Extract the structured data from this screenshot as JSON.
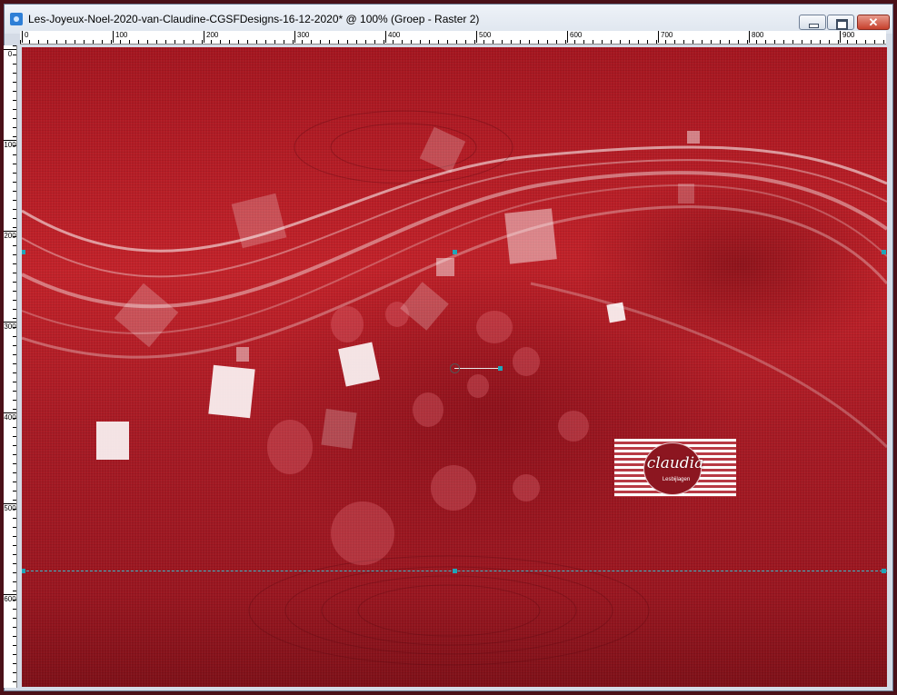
{
  "window": {
    "title": "Les-Joyeux-Noel-2020-van-Claudine-CGSFDesigns-16-12-2020* @ 100% (Groep - Raster 2)",
    "icons": {
      "app": "psp-document-icon",
      "minimize": "minimize-icon",
      "maximize": "maximize-icon",
      "close": "close-icon"
    },
    "close_glyph": "✕"
  },
  "ruler": {
    "top_labels": [
      "0",
      "100",
      "200",
      "300",
      "400",
      "500",
      "600",
      "700",
      "800",
      "900"
    ],
    "left_labels": [
      "0",
      "100",
      "200",
      "300",
      "400",
      "500",
      "600"
    ]
  },
  "canvas": {
    "watermark_text": "claudia",
    "watermark_subtext": "Lesbijlagen",
    "colors": {
      "background": "#b01c24",
      "guide": "#3fb6c8",
      "handle": "#1fa5b8"
    }
  }
}
